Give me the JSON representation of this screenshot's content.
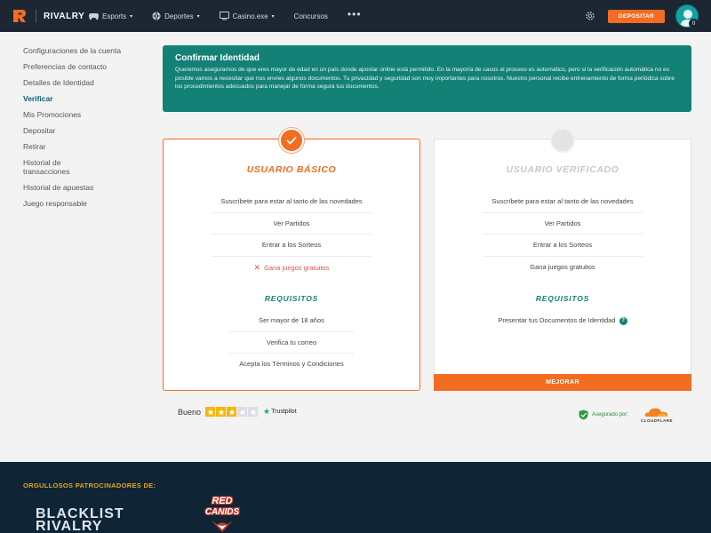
{
  "brand": {
    "name": "RIVALRY",
    "accent": "#f26c21",
    "teal": "#138176",
    "nav_bg": "#1c2733"
  },
  "nav": {
    "items": [
      {
        "label": "Esports",
        "icon": "controller-icon",
        "has_caret": true
      },
      {
        "label": "Deportes",
        "icon": "ball-icon",
        "has_caret": true
      },
      {
        "label": "Casino.exe",
        "icon": "monitor-icon",
        "has_caret": true
      },
      {
        "label": "Concursos",
        "icon": "",
        "has_caret": false
      }
    ],
    "more_label": "•••",
    "deposit_label": "DEPOSITAR",
    "avatar_badge": "0"
  },
  "sidebar": {
    "items": [
      {
        "label": "Configuraciones de la cuenta",
        "active": false
      },
      {
        "label": "Preferencias de contacto",
        "active": false
      },
      {
        "label": "Detalles de Identidad",
        "active": false
      },
      {
        "label": "Verificar",
        "active": true
      },
      {
        "label": "Mis Promociones",
        "active": false
      },
      {
        "label": "Depositar",
        "active": false
      },
      {
        "label": "Retirar",
        "active": false
      },
      {
        "label": "Historial de transacciones",
        "active": false
      },
      {
        "label": "Historial de apuestas",
        "active": false
      },
      {
        "label": "Juego responsable",
        "active": false
      }
    ]
  },
  "banner": {
    "title": "Confirmar Identidad",
    "text": "Queremos asegurarnos de que eres mayor de edad en un país donde apostar online está permitido. En la mayoría de casos el proceso es automático, pero si la verificación automática no es posible vamos a necesitar que nos envíes algunos documentos. Tu privacidad y seguridad son muy importantes para nosotros. Nuestro personal recibe entrenamiento de forma periódica sobre los procedimientos adecuados para manejar de forma segura tus documentos."
  },
  "cards": {
    "basic": {
      "title": "USUARIO BÁSICO",
      "features": [
        {
          "label": "Suscríbete para estar al tanto de las novedades",
          "available": true
        },
        {
          "label": "Ver Partidos",
          "available": true
        },
        {
          "label": "Entrar a los Sorteos",
          "available": true
        },
        {
          "label": "Gana juegos gratuitos",
          "available": false
        }
      ],
      "requirements_title": "REQUISITOS",
      "requirements": [
        "Ser mayor de 18 años",
        "Verifica tu correo",
        "Acepta los Términos y Condiciones"
      ]
    },
    "verified": {
      "title": "USUARIO VERIFICADO",
      "features": [
        {
          "label": "Suscríbete para estar al tanto de las novedades",
          "available": true
        },
        {
          "label": "Ver Partidos",
          "available": true
        },
        {
          "label": "Entrar a los Sorteos",
          "available": true
        },
        {
          "label": "Gana juegos gratuitos",
          "available": true
        }
      ],
      "requirements_title": "REQUISITOS",
      "requirements": [
        "Presentar tus Documentos de Identidad"
      ],
      "button_label": "MEJORAR"
    }
  },
  "trust": {
    "rating_label": "Bueno",
    "stars_filled": 3,
    "stars_total": 5,
    "provider": "Trustpilot",
    "secured_label": "Asegurado por:",
    "cloudflare_label": "CLOUDFLARE"
  },
  "footer": {
    "sponsors_title": "ORGULLOSOS PATROCINADORES DE:",
    "sponsor_1_line1": "BLACKLIST",
    "sponsor_1_line2": "RIVALRY",
    "sponsor_2_line1": "RED",
    "sponsor_2_line2": "CANIDS"
  }
}
